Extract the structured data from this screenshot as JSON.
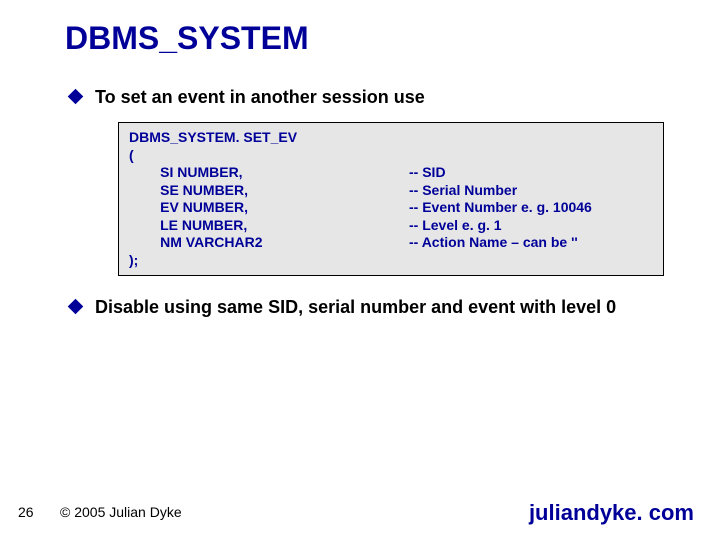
{
  "title": "DBMS_SYSTEM",
  "bullets": {
    "b1": "To set an event in another session use",
    "b2": "Disable using same SID, serial number and event with level 0"
  },
  "code": {
    "l1": "DBMS_SYSTEM. SET_EV",
    "l2": "(",
    "p1_left": "        SI NUMBER,",
    "p1_right": "-- SID",
    "p2_left": "        SE NUMBER,",
    "p2_right": "-- Serial Number",
    "p3_left": "        EV NUMBER,",
    "p3_right": "-- Event Number e. g. 10046",
    "p4_left": "        LE NUMBER,",
    "p4_right": "-- Level e. g. 1",
    "p5_left": "        NM VARCHAR2",
    "p5_right": "-- Action Name – can be ''",
    "l8": ");"
  },
  "footer": {
    "page": "26",
    "copyright": "© 2005 Julian Dyke",
    "site": "juliandyke. com"
  }
}
